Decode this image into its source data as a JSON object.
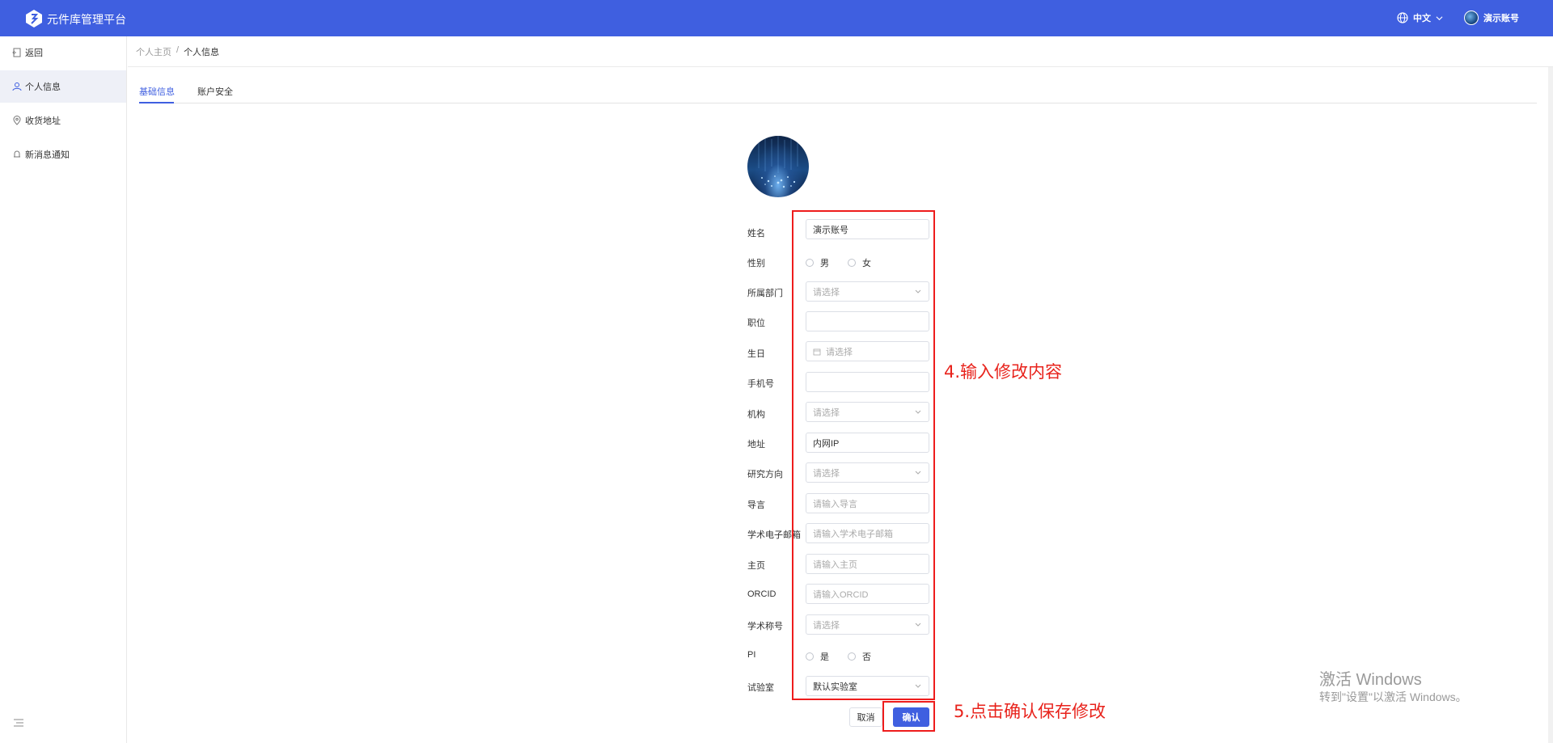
{
  "header": {
    "app_title": "元件库管理平台",
    "language": "中文",
    "user_name": "演示账号",
    "brand_color": "#3f5fe0"
  },
  "sidebar": {
    "items": [
      {
        "label": "返回",
        "icon": "back-icon"
      },
      {
        "label": "个人信息",
        "icon": "user-icon"
      },
      {
        "label": "收货地址",
        "icon": "location-icon"
      },
      {
        "label": "新消息通知",
        "icon": "bell-icon"
      }
    ]
  },
  "breadcrumb": {
    "home": "个人主页",
    "separator": "/",
    "current": "个人信息"
  },
  "tabs": {
    "basic": "基础信息",
    "security": "账户安全"
  },
  "form": {
    "name_label": "姓名",
    "name_value": "演示账号",
    "gender_label": "性别",
    "gender_male": "男",
    "gender_female": "女",
    "department_label": "所属部门",
    "department_placeholder": "请选择",
    "position_label": "职位",
    "birthday_label": "生日",
    "birthday_placeholder": "请选择",
    "phone_label": "手机号",
    "institution_label": "机构",
    "institution_placeholder": "请选择",
    "address_label": "地址",
    "address_value": "内网IP",
    "research_label": "研究方向",
    "research_placeholder": "请选择",
    "advisor_label": "导言",
    "advisor_placeholder": "请输入导言",
    "email_label": "学术电子邮箱",
    "email_placeholder": "请输入学术电子邮箱",
    "homepage_label": "主页",
    "homepage_placeholder": "请输入主页",
    "orcid_label": "ORCID",
    "orcid_placeholder": "请输入ORCID",
    "title_label": "学术称号",
    "title_placeholder": "请选择",
    "pi_label": "PI",
    "pi_yes": "是",
    "pi_no": "否",
    "lab_label": "试验室",
    "lab_value": "默认实验室",
    "cancel_label": "取消",
    "confirm_label": "确认"
  },
  "annotations": {
    "step4": "4.输入修改内容",
    "step5": "5.点击确认保存修改"
  },
  "watermark": {
    "line1": "激活 Windows",
    "line2": "转到\"设置\"以激活 Windows。"
  }
}
